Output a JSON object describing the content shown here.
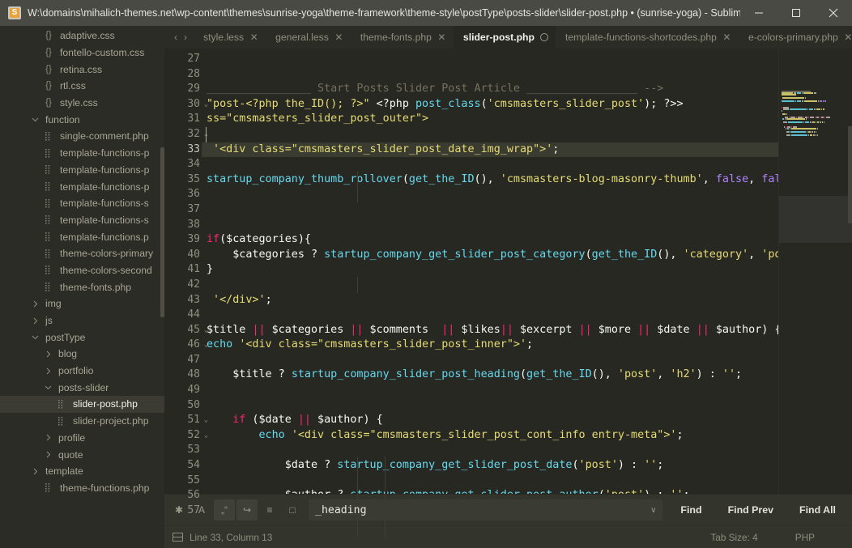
{
  "window": {
    "title": "W:\\domains\\mihalich-themes.net\\wp-content\\themes\\sunrise-yoga\\theme-framework\\theme-style\\postType\\posts-slider\\slider-post.php • (sunrise-yoga) - Sublim...",
    "app_icon": "sublime-text-icon",
    "minimize_label": "–",
    "maximize_label": "☐",
    "close_label": "✕"
  },
  "sidebar": {
    "items": [
      {
        "label": "adaptive.css",
        "icon": "braces-icon",
        "indent": 3,
        "kind": "file",
        "selected": false
      },
      {
        "label": "fontello-custom.css",
        "icon": "braces-icon",
        "indent": 3,
        "kind": "file",
        "selected": false
      },
      {
        "label": "retina.css",
        "icon": "braces-icon",
        "indent": 3,
        "kind": "file",
        "selected": false
      },
      {
        "label": "rtl.css",
        "icon": "braces-icon",
        "indent": 3,
        "kind": "file",
        "selected": false
      },
      {
        "label": "style.css",
        "icon": "braces-icon",
        "indent": 3,
        "kind": "file",
        "selected": false
      },
      {
        "label": "function",
        "icon": "chevron-down-icon",
        "indent": 2,
        "kind": "folder-open",
        "selected": false
      },
      {
        "label": "single-comment.php",
        "icon": "php-file-icon",
        "indent": 3,
        "kind": "file",
        "selected": false
      },
      {
        "label": "template-functions-p",
        "icon": "php-file-icon",
        "indent": 3,
        "kind": "file",
        "selected": false
      },
      {
        "label": "template-functions-p",
        "icon": "php-file-icon",
        "indent": 3,
        "kind": "file",
        "selected": false
      },
      {
        "label": "template-functions-p",
        "icon": "php-file-icon",
        "indent": 3,
        "kind": "file",
        "selected": false
      },
      {
        "label": "template-functions-s",
        "icon": "php-file-icon",
        "indent": 3,
        "kind": "file",
        "selected": false
      },
      {
        "label": "template-functions-s",
        "icon": "php-file-icon",
        "indent": 3,
        "kind": "file",
        "selected": false
      },
      {
        "label": "template-functions.p",
        "icon": "php-file-icon",
        "indent": 3,
        "kind": "file",
        "selected": false
      },
      {
        "label": "theme-colors-primary",
        "icon": "php-file-icon",
        "indent": 3,
        "kind": "file",
        "selected": false
      },
      {
        "label": "theme-colors-second",
        "icon": "php-file-icon",
        "indent": 3,
        "kind": "file",
        "selected": false
      },
      {
        "label": "theme-fonts.php",
        "icon": "php-file-icon",
        "indent": 3,
        "kind": "file",
        "selected": false
      },
      {
        "label": "img",
        "icon": "chevron-right-icon",
        "indent": 2,
        "kind": "folder",
        "selected": false
      },
      {
        "label": "js",
        "icon": "chevron-right-icon",
        "indent": 2,
        "kind": "folder",
        "selected": false
      },
      {
        "label": "postType",
        "icon": "chevron-down-icon",
        "indent": 2,
        "kind": "folder-open",
        "selected": false
      },
      {
        "label": "blog",
        "icon": "chevron-right-icon",
        "indent": 3,
        "kind": "folder",
        "selected": false
      },
      {
        "label": "portfolio",
        "icon": "chevron-right-icon",
        "indent": 3,
        "kind": "folder",
        "selected": false
      },
      {
        "label": "posts-slider",
        "icon": "chevron-down-icon",
        "indent": 3,
        "kind": "folder-open",
        "selected": false
      },
      {
        "label": "slider-post.php",
        "icon": "php-file-icon",
        "indent": 4,
        "kind": "file",
        "selected": true
      },
      {
        "label": "slider-project.php",
        "icon": "php-file-icon",
        "indent": 4,
        "kind": "file",
        "selected": false
      },
      {
        "label": "profile",
        "icon": "chevron-right-icon",
        "indent": 3,
        "kind": "folder",
        "selected": false
      },
      {
        "label": "quote",
        "icon": "chevron-right-icon",
        "indent": 3,
        "kind": "folder",
        "selected": false
      },
      {
        "label": "template",
        "icon": "chevron-right-icon",
        "indent": 2,
        "kind": "folder",
        "selected": false
      },
      {
        "label": "theme-functions.php",
        "icon": "php-file-icon",
        "indent": 3,
        "kind": "file",
        "selected": false
      }
    ]
  },
  "tabs": {
    "nav_prev": "‹",
    "nav_next": "›",
    "items": [
      {
        "label": "style.less",
        "active": false,
        "modified": false
      },
      {
        "label": "general.less",
        "active": false,
        "modified": false
      },
      {
        "label": "theme-fonts.php",
        "active": false,
        "modified": false
      },
      {
        "label": "slider-post.php",
        "active": true,
        "modified": true
      },
      {
        "label": "template-functions-shortcodes.php",
        "active": false,
        "modified": false
      },
      {
        "label": "e-colors-primary.php",
        "active": false,
        "modified": false
      }
    ],
    "close_glyph": "✕",
    "menu_glyph": "∨"
  },
  "editor": {
    "first_line": 27,
    "highlight_line": 33,
    "fold_lines": [
      30,
      32,
      33,
      45,
      46,
      51,
      52
    ],
    "lines": [
      {
        "n": 27,
        "tokens": []
      },
      {
        "n": 28,
        "tokens": []
      },
      {
        "n": 29,
        "tokens": [
          {
            "t": "________________ Start Posts Slider Post Article _________________ -->",
            "c": "s-com",
            "pad": 0
          }
        ]
      },
      {
        "n": 30,
        "tokens": [
          {
            "t": "\"post-<?php the_ID(); ?>\" ",
            "c": "s-str"
          },
          {
            "t": "<?php ",
            "c": "s-plain"
          },
          {
            "t": "post_class",
            "c": "s-fn"
          },
          {
            "t": "(",
            "c": "s-plain"
          },
          {
            "t": "'cmsmasters_slider_post'",
            "c": "s-str"
          },
          {
            "t": "); ?>>",
            "c": "s-plain"
          }
        ]
      },
      {
        "n": 31,
        "tokens": [
          {
            "t": "ss=\"cmsmasters_slider_post_outer\">",
            "c": "s-str"
          }
        ]
      },
      {
        "n": 32,
        "tokens": []
      },
      {
        "n": 33,
        "tokens": [
          {
            "t": " '<div class=\"cmsmasters_slider_post_date_img_wrap\">'",
            "c": "s-str"
          },
          {
            "t": ";",
            "c": "s-plain"
          }
        ]
      },
      {
        "n": 34,
        "tokens": []
      },
      {
        "n": 35,
        "tokens": [
          {
            "t": "startup_company_thumb_rollover",
            "c": "s-fn"
          },
          {
            "t": "(",
            "c": "s-plain"
          },
          {
            "t": "get_the_ID",
            "c": "s-fn"
          },
          {
            "t": "(), ",
            "c": "s-plain"
          },
          {
            "t": "'cmsmasters-blog-masonry-thumb'",
            "c": "s-str"
          },
          {
            "t": ", ",
            "c": "s-plain"
          },
          {
            "t": "false",
            "c": "s-num"
          },
          {
            "t": ", ",
            "c": "s-plain"
          },
          {
            "t": "fals",
            "c": "s-num"
          }
        ]
      },
      {
        "n": 36,
        "tokens": []
      },
      {
        "n": 37,
        "tokens": []
      },
      {
        "n": 38,
        "tokens": []
      },
      {
        "n": 39,
        "tokens": [
          {
            "t": "if",
            "c": "s-kw"
          },
          {
            "t": "($categories){",
            "c": "s-plain"
          }
        ]
      },
      {
        "n": 40,
        "tokens": [
          {
            "t": "    $categories ? ",
            "c": "s-plain"
          },
          {
            "t": "startup_company_get_slider_post_category",
            "c": "s-fn"
          },
          {
            "t": "(",
            "c": "s-plain"
          },
          {
            "t": "get_the_ID",
            "c": "s-fn"
          },
          {
            "t": "(), ",
            "c": "s-plain"
          },
          {
            "t": "'category'",
            "c": "s-str"
          },
          {
            "t": ", ",
            "c": "s-plain"
          },
          {
            "t": "'pos",
            "c": "s-str"
          }
        ]
      },
      {
        "n": 41,
        "tokens": [
          {
            "t": "}",
            "c": "s-plain"
          }
        ]
      },
      {
        "n": 42,
        "tokens": []
      },
      {
        "n": 43,
        "tokens": [
          {
            "t": " '</div>'",
            "c": "s-str"
          },
          {
            "t": ";",
            "c": "s-plain"
          }
        ]
      },
      {
        "n": 44,
        "tokens": []
      },
      {
        "n": 45,
        "tokens": [
          {
            "t": "$title ",
            "c": "s-plain"
          },
          {
            "t": "||",
            "c": "s-op"
          },
          {
            "t": " $categories ",
            "c": "s-plain"
          },
          {
            "t": "||",
            "c": "s-op"
          },
          {
            "t": " $comments  ",
            "c": "s-plain"
          },
          {
            "t": "||",
            "c": "s-op"
          },
          {
            "t": " $likes",
            "c": "s-plain"
          },
          {
            "t": "||",
            "c": "s-op"
          },
          {
            "t": " $excerpt ",
            "c": "s-plain"
          },
          {
            "t": "||",
            "c": "s-op"
          },
          {
            "t": " $more ",
            "c": "s-plain"
          },
          {
            "t": "||",
            "c": "s-op"
          },
          {
            "t": " $date ",
            "c": "s-plain"
          },
          {
            "t": "||",
            "c": "s-op"
          },
          {
            "t": " $author) {",
            "c": "s-plain"
          }
        ]
      },
      {
        "n": 46,
        "tokens": [
          {
            "t": "echo",
            "c": "s-fn"
          },
          {
            "t": " ",
            "c": "s-plain"
          },
          {
            "t": "'<div class=\"cmsmasters_slider_post_inner\">'",
            "c": "s-str"
          },
          {
            "t": ";",
            "c": "s-plain"
          }
        ]
      },
      {
        "n": 47,
        "tokens": []
      },
      {
        "n": 48,
        "tokens": [
          {
            "t": "    $title ? ",
            "c": "s-plain"
          },
          {
            "t": "startup_company_slider_post_heading",
            "c": "s-fn"
          },
          {
            "t": "(",
            "c": "s-plain"
          },
          {
            "t": "get_the_ID",
            "c": "s-fn"
          },
          {
            "t": "(), ",
            "c": "s-plain"
          },
          {
            "t": "'post'",
            "c": "s-str"
          },
          {
            "t": ", ",
            "c": "s-plain"
          },
          {
            "t": "'h2'",
            "c": "s-str"
          },
          {
            "t": ") : ",
            "c": "s-plain"
          },
          {
            "t": "''",
            "c": "s-str"
          },
          {
            "t": ";",
            "c": "s-plain"
          }
        ]
      },
      {
        "n": 49,
        "tokens": []
      },
      {
        "n": 50,
        "tokens": []
      },
      {
        "n": 51,
        "tokens": [
          {
            "t": "    ",
            "c": "s-plain"
          },
          {
            "t": "if",
            "c": "s-kw"
          },
          {
            "t": " ($date ",
            "c": "s-plain"
          },
          {
            "t": "||",
            "c": "s-op"
          },
          {
            "t": " $author) {",
            "c": "s-plain"
          }
        ]
      },
      {
        "n": 52,
        "tokens": [
          {
            "t": "        ",
            "c": "s-plain"
          },
          {
            "t": "echo",
            "c": "s-fn"
          },
          {
            "t": " ",
            "c": "s-plain"
          },
          {
            "t": "'<div class=\"cmsmasters_slider_post_cont_info entry-meta\">'",
            "c": "s-str"
          },
          {
            "t": ";",
            "c": "s-plain"
          }
        ]
      },
      {
        "n": 53,
        "tokens": []
      },
      {
        "n": 54,
        "tokens": [
          {
            "t": "            $date ? ",
            "c": "s-plain"
          },
          {
            "t": "startup_company_get_slider_post_date",
            "c": "s-fn"
          },
          {
            "t": "(",
            "c": "s-plain"
          },
          {
            "t": "'post'",
            "c": "s-str"
          },
          {
            "t": ") : ",
            "c": "s-plain"
          },
          {
            "t": "''",
            "c": "s-str"
          },
          {
            "t": ";",
            "c": "s-plain"
          }
        ]
      },
      {
        "n": 55,
        "tokens": []
      },
      {
        "n": 56,
        "tokens": [
          {
            "t": "            $author ? ",
            "c": "s-plain"
          },
          {
            "t": "startup_company_get_slider_post_author",
            "c": "s-fn"
          },
          {
            "t": "(",
            "c": "s-plain"
          },
          {
            "t": "'post'",
            "c": "s-str"
          },
          {
            "t": ") : ",
            "c": "s-plain"
          },
          {
            "t": "''",
            "c": "s-str"
          },
          {
            "t": ";",
            "c": "s-plain"
          }
        ]
      },
      {
        "n": 57,
        "tokens": []
      }
    ]
  },
  "find_bar": {
    "toggles": [
      {
        "name": "regex-toggle",
        "glyph": "✱",
        "active": false
      },
      {
        "name": "case-sensitive-toggle",
        "glyph": "A",
        "active": false
      },
      {
        "name": "whole-word-toggle",
        "glyph": "„“",
        "active": true
      },
      {
        "name": "wrap-toggle",
        "glyph": "↪",
        "active": true
      },
      {
        "name": "in-selection-toggle",
        "glyph": "≡",
        "active": false
      },
      {
        "name": "highlight-results-toggle",
        "glyph": "□",
        "active": false
      }
    ],
    "search_value": "_heading",
    "search_placeholder": "Find",
    "dropdown_glyph": "∨",
    "buttons": [
      {
        "label": "Find"
      },
      {
        "label": "Find Prev"
      },
      {
        "label": "Find All"
      }
    ]
  },
  "status_bar": {
    "layout_icon": "panel-icon",
    "cursor": "Line 33, Column 13",
    "tab_size": "Tab Size: 4",
    "syntax": "PHP"
  },
  "colors": {
    "titlebar_bg": "#4a4a44",
    "sidebar_bg": "#2c2c26",
    "editor_bg": "#272822",
    "chrome_bg": "#33342c",
    "highlight_line_bg": "#3b3c31",
    "keyword": "#f92672",
    "function": "#66d9ef",
    "string": "#e6db74",
    "comment": "#75715e",
    "constant": "#ae81ff",
    "foreground": "#f8f8f2"
  }
}
